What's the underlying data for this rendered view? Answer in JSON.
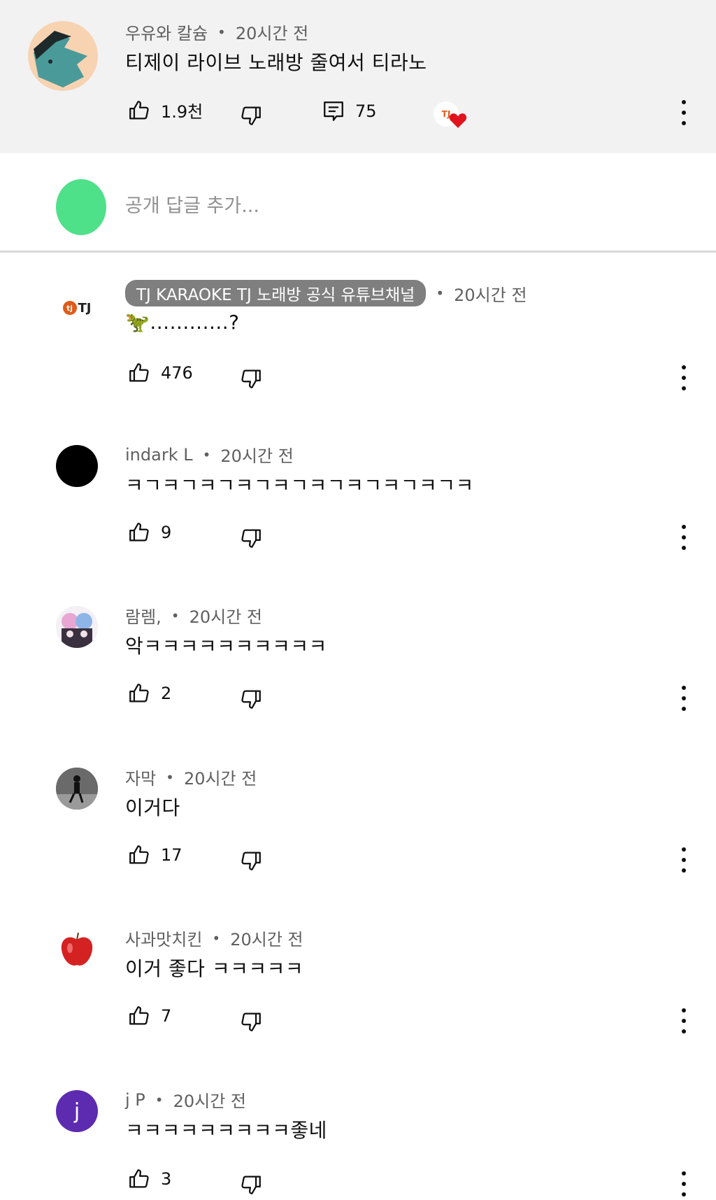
{
  "top_comment": {
    "author": "우유와 칼슘",
    "time": "20시간 전",
    "text": "티제이 라이브 노래방 줄여서 티라노",
    "likes": "1.9천",
    "replies": "75",
    "heart_badge": "TJ"
  },
  "reply_input": {
    "placeholder": "공개 답글 추가..."
  },
  "replies": [
    {
      "author": "TJ KARAOKE TJ 노래방 공식 유튜브채널",
      "time": "20시간 전",
      "text": "🦖............?",
      "likes": "476",
      "avatar": "TJ"
    },
    {
      "author": "indark L",
      "time": "20시간 전",
      "text": "ㅋㄱㅋㄱㅋㄱㅋㄱㅋㄱㅋㄱㅋㄱㅋㄱㅋㄱㅋ",
      "likes": "9"
    },
    {
      "author": "람렘,",
      "time": "20시간 전",
      "text": "악ㅋㅋㅋㅋㅋㅋㅋㅋㅋㅋ",
      "likes": "2"
    },
    {
      "author": "자막",
      "time": "20시간 전",
      "text": "이거다",
      "likes": "17"
    },
    {
      "author": "사과맛치킨",
      "time": "20시간 전",
      "text": "이거 좋다 ㅋㅋㅋㅋㅋ",
      "likes": "7"
    },
    {
      "author": "j P",
      "time": "20시간 전",
      "text": "ㅋㅋㅋㅋㅋㅋㅋㅋㅋ좋네",
      "likes": "3",
      "avatar": "j"
    }
  ],
  "colors": {
    "top_bg": "#f2f2f2",
    "chip_bg": "#7f7f7f",
    "heart": "#e0141e",
    "jp_avatar": "#5c2bb0"
  }
}
